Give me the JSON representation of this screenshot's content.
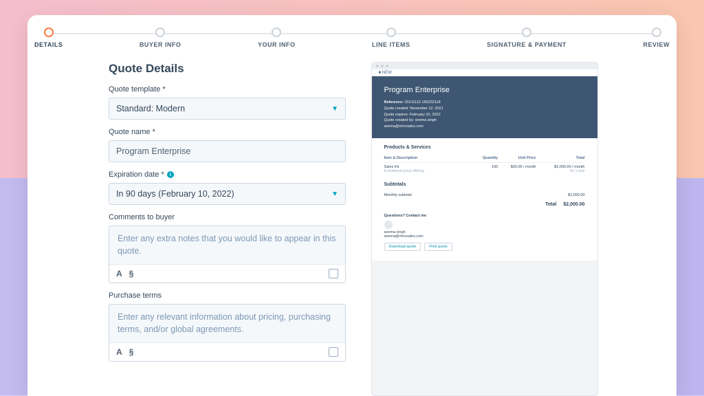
{
  "stepper": {
    "items": [
      {
        "label": "DETAILS",
        "active": true
      },
      {
        "label": "BUYER INFO"
      },
      {
        "label": "YOUR INFO"
      },
      {
        "label": "LINE ITEMS"
      },
      {
        "label": "SIGNATURE & PAYMENT"
      },
      {
        "label": "REVIEW"
      }
    ]
  },
  "form": {
    "title": "Quote Details",
    "template_label": "Quote template *",
    "template_value": "Standard: Modern",
    "name_label": "Quote name *",
    "name_value": "Program Enterprise",
    "expiration_label": "Expiration date *",
    "expiration_value": "In 90 days (February 10, 2022)",
    "comments_label": "Comments to buyer",
    "comments_placeholder": "Enter any extra notes that you would like to appear in this quote.",
    "terms_label": "Purchase terms",
    "terms_placeholder": "Enter any relevant information about pricing, purchasing terms, and/or global agreements.",
    "tool_font": "A",
    "tool_attach": "§"
  },
  "preview": {
    "url_badge": "■ NEW",
    "title": "Program Enterprise",
    "ref_label": "Reference:",
    "ref_value": "20211112-165202118",
    "created_label": "Quote created:",
    "created_value": "November 12, 2021",
    "expires_label": "Quote expires:",
    "expires_value": "February 10, 2022",
    "createdby_label": "Quote created by:",
    "createdby_value": "seema singh",
    "contact_email": "seema@mrivsales.com",
    "products_heading": "Products & Services",
    "col_item": "Item & Description",
    "col_qty": "Quantity",
    "col_price": "Unit Price",
    "col_total": "Total",
    "line_name": "Sales Kit",
    "line_desc": "A combined group offering",
    "line_qty": "100",
    "line_price": "$20.00 / month",
    "line_total": "$2,000.00 / month",
    "line_term": "for 1 year",
    "subtotals_heading": "Subtotals",
    "monthly_label": "Monthly subtotal",
    "monthly_value": "$2,000.00",
    "total_label": "Total",
    "total_value": "$2,000.00",
    "questions": "Questions? Contact me",
    "contact_name": "seema singh",
    "btn_download": "Download quote",
    "btn_print": "Print quote"
  }
}
